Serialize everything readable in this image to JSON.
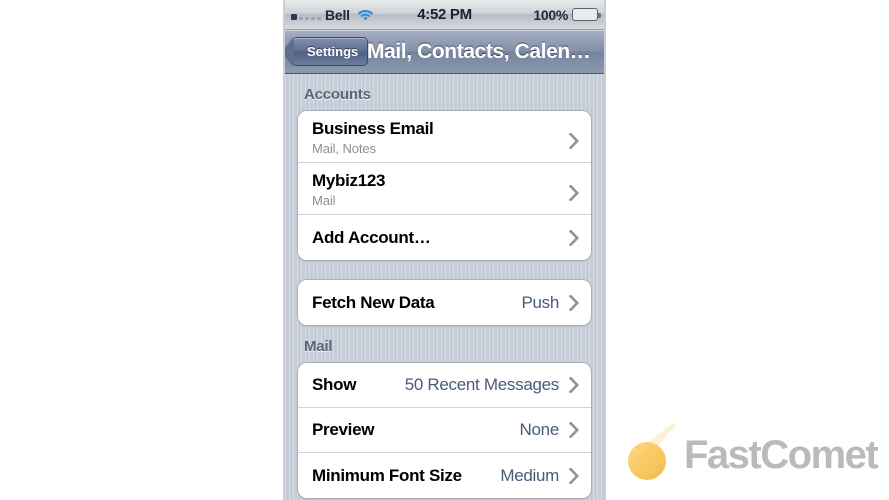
{
  "status_bar": {
    "carrier": "Bell",
    "wifi_icon": "wifi-icon",
    "signal_icon": "signal-dots-icon",
    "time": "4:52 PM",
    "battery_percent": "100%",
    "battery_icon": "battery-full-icon"
  },
  "nav_bar": {
    "back_label": "Settings",
    "title": "Mail, Contacts, Calen…"
  },
  "sections": [
    {
      "header": "Accounts",
      "rows": [
        {
          "title": "Business Email",
          "subtitle": "Mail, Notes",
          "value": "",
          "chevron": "chevron-right-icon"
        },
        {
          "title": "Mybiz123",
          "subtitle": "Mail",
          "value": "",
          "chevron": "chevron-right-icon"
        },
        {
          "title": "Add Account…",
          "subtitle": "",
          "value": "",
          "chevron": "chevron-right-icon"
        }
      ]
    },
    {
      "header": "",
      "rows": [
        {
          "title": "Fetch New Data",
          "subtitle": "",
          "value": "Push",
          "chevron": "chevron-right-icon"
        }
      ]
    },
    {
      "header": "Mail",
      "rows": [
        {
          "title": "Show",
          "subtitle": "",
          "value": "50 Recent Messages",
          "chevron": "chevron-right-icon"
        },
        {
          "title": "Preview",
          "subtitle": "",
          "value": "None",
          "chevron": "chevron-right-icon"
        },
        {
          "title": "Minimum Font Size",
          "subtitle": "",
          "value": "Medium",
          "chevron": "chevron-right-icon"
        }
      ]
    }
  ],
  "watermark": {
    "text": "FastComet",
    "icon": "comet-icon"
  },
  "colors": {
    "navbar_blue": "#8490a9",
    "value_text": "#495b78",
    "section_header": "#5c6578",
    "battery_green": "#7ac943",
    "watermark_gray": "#b9babb",
    "comet_orange": "#f5c45a"
  }
}
